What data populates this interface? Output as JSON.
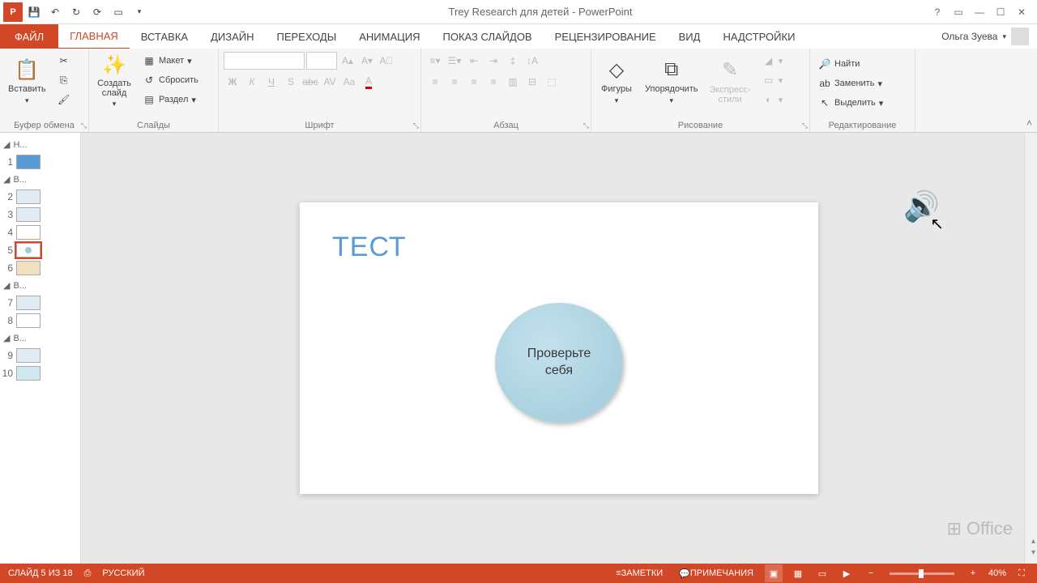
{
  "title": "Trey Research для детей - PowerPoint",
  "user": "Ольга Зуева",
  "tabs": {
    "file": "ФАЙЛ",
    "home": "ГЛАВНАЯ",
    "insert": "ВСТАВКА",
    "design": "ДИЗАЙН",
    "transitions": "ПЕРЕХОДЫ",
    "animations": "АНИМАЦИЯ",
    "slideshow": "ПОКАЗ СЛАЙДОВ",
    "review": "РЕЦЕНЗИРОВАНИЕ",
    "view": "ВИД",
    "addins": "НАДСТРОЙКИ"
  },
  "ribbon": {
    "clipboard": {
      "label": "Буфер обмена",
      "paste": "Вставить"
    },
    "slides": {
      "label": "Слайды",
      "new": "Создать\nслайд",
      "layout": "Макет",
      "reset": "Сбросить",
      "section": "Раздел"
    },
    "font": {
      "label": "Шрифт"
    },
    "paragraph": {
      "label": "Абзац"
    },
    "drawing": {
      "label": "Рисование",
      "shapes": "Фигуры",
      "arrange": "Упорядочить",
      "styles": "Экспресс-\nстили"
    },
    "editing": {
      "label": "Редактирование",
      "find": "Найти",
      "replace": "Заменить",
      "select": "Выделить"
    }
  },
  "sections": {
    "s1": "Н...",
    "s2": "В...",
    "s3": "В...",
    "s4": "В..."
  },
  "slideNumbers": [
    "1",
    "2",
    "3",
    "4",
    "5",
    "6",
    "7",
    "8",
    "9",
    "10"
  ],
  "slide": {
    "title": "ТЕСТ",
    "circle": "Проверьте\nсебя"
  },
  "status": {
    "slide": "СЛАЙД 5 ИЗ 18",
    "lang": "РУССКИЙ",
    "notes": "ЗАМЕТКИ",
    "comments": "ПРИМЕЧАНИЯ",
    "zoom": "40%"
  },
  "office": "Office"
}
